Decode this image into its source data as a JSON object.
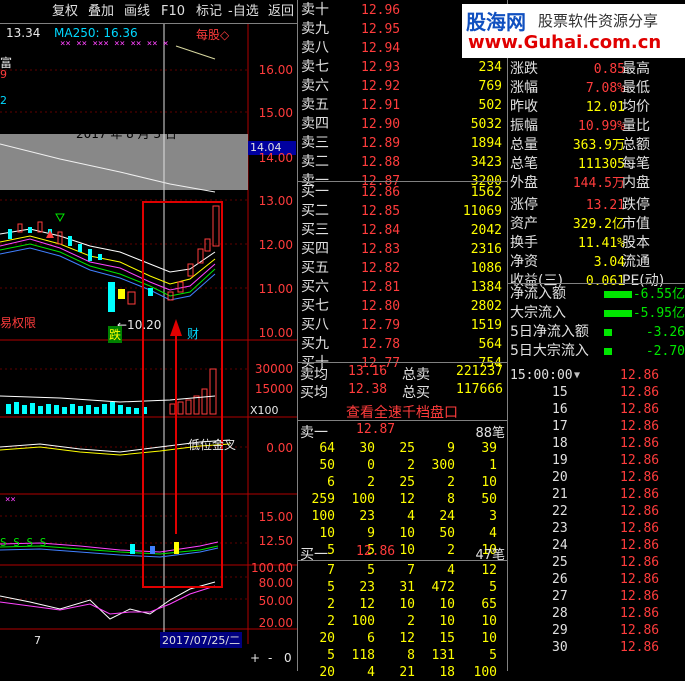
{
  "toolbar": {
    "items": [
      "复权",
      "叠加",
      "画线",
      "F10",
      "标记",
      "-自选",
      "返回"
    ]
  },
  "chart": {
    "ma_price": "13.34",
    "ma250": "MA250: 16.36",
    "every": "每股◇",
    "left_frag1": "富",
    "left_frag2": "9",
    "left_frag3": "2",
    "date_annot": "2017 年 8 月 3 日",
    "price_box": "14.04",
    "low_label": "←10.20",
    "tag_die": "跌",
    "tag_cai": "财",
    "rights_text": "易权限",
    "ind_label": "低位金叉",
    "x100": "X100",
    "bottom_date": "2017/07/25/二",
    "bottom_left": "7",
    "nav": [
      "+",
      "-",
      "0"
    ],
    "yticks_main": [
      "16.00",
      "15.00",
      "14.00",
      "13.00",
      "12.00",
      "11.00",
      "10.00"
    ],
    "yticks_vol": [
      "30000",
      "15000"
    ],
    "yticks_ind": [
      "0.00"
    ],
    "yticks_ind2": [
      "15.00",
      "12.50"
    ],
    "yticks_ind3": [
      "100.00",
      "80.00",
      "50.00",
      "20.00"
    ]
  },
  "watermark": {
    "line1": "股海网",
    "line2": "股票软件资源分享",
    "url": "www.Guhai.com.cn"
  },
  "orderbook": {
    "asks": [
      {
        "label": "卖十",
        "price": "12.96",
        "vol": ""
      },
      {
        "label": "卖九",
        "price": "12.95",
        "vol": ""
      },
      {
        "label": "卖八",
        "price": "12.94",
        "vol": ""
      },
      {
        "label": "卖七",
        "price": "12.93",
        "vol": "234"
      },
      {
        "label": "卖六",
        "price": "12.92",
        "vol": "769"
      },
      {
        "label": "卖五",
        "price": "12.91",
        "vol": "502"
      },
      {
        "label": "卖四",
        "price": "12.90",
        "vol": "5032"
      },
      {
        "label": "卖三",
        "price": "12.89",
        "vol": "1894"
      },
      {
        "label": "卖二",
        "price": "12.88",
        "vol": "3423"
      },
      {
        "label": "卖一",
        "price": "12.87",
        "vol": "3200"
      }
    ],
    "bids": [
      {
        "label": "买一",
        "price": "12.86",
        "vol": "1562"
      },
      {
        "label": "买二",
        "price": "12.85",
        "vol": "11069"
      },
      {
        "label": "买三",
        "price": "12.84",
        "vol": "2042"
      },
      {
        "label": "买四",
        "price": "12.83",
        "vol": "2316"
      },
      {
        "label": "买五",
        "price": "12.82",
        "vol": "1086"
      },
      {
        "label": "买六",
        "price": "12.81",
        "vol": "1384"
      },
      {
        "label": "买七",
        "price": "12.80",
        "vol": "2802"
      },
      {
        "label": "买八",
        "price": "12.79",
        "vol": "1519"
      },
      {
        "label": "买九",
        "price": "12.78",
        "vol": "564"
      },
      {
        "label": "买十",
        "price": "12.77",
        "vol": "754"
      }
    ],
    "avg_sell_label": "卖均",
    "avg_sell": "13.16",
    "total_sell_label": "总卖",
    "total_sell": "221237",
    "avg_buy_label": "买均",
    "avg_buy": "12.38",
    "total_buy_label": "总买",
    "total_buy": "117666",
    "view_all": "查看全速千档盘口"
  },
  "queue": {
    "sell_label": "卖一",
    "sell_price": "12.87",
    "sell_count": "88笔",
    "sell_rows": [
      [
        "64",
        "30",
        "25",
        "9",
        "39"
      ],
      [
        "50",
        "0",
        "2",
        "300",
        "1"
      ],
      [
        "6",
        "2",
        "25",
        "2",
        "10"
      ],
      [
        "259",
        "100",
        "12",
        "8",
        "50"
      ],
      [
        "100",
        "23",
        "4",
        "24",
        "3"
      ],
      [
        "10",
        "9",
        "10",
        "50",
        "4"
      ],
      [
        "5",
        "5",
        "10",
        "2",
        "10"
      ]
    ],
    "buy_label": "买一",
    "buy_price": "12.86",
    "buy_count": "47笔",
    "buy_rows": [
      [
        "7",
        "5",
        "7",
        "4",
        "12"
      ],
      [
        "5",
        "23",
        "31",
        "472",
        "5"
      ],
      [
        "2",
        "12",
        "10",
        "10",
        "65"
      ],
      [
        "2",
        "100",
        "2",
        "10",
        "10"
      ],
      [
        "20",
        "6",
        "12",
        "15",
        "10"
      ],
      [
        "5",
        "118",
        "8",
        "131",
        "5"
      ],
      [
        "20",
        "4",
        "21",
        "18",
        "100"
      ]
    ]
  },
  "stats": {
    "rows": [
      {
        "a": "涨跌",
        "b": "0.85",
        "c": "最高"
      },
      {
        "a": "涨幅",
        "b": "7.08%",
        "c": "最低"
      },
      {
        "a": "昨收",
        "b": "12.01",
        "c": "均价"
      },
      {
        "a": "振幅",
        "b": "10.99%",
        "c": "量比"
      },
      {
        "a": "总量",
        "b": "363.9万",
        "c": "总额"
      },
      {
        "a": "总笔",
        "b": "111305",
        "c": "每笔"
      },
      {
        "a": "外盘",
        "b": "144.5万",
        "c": "内盘"
      },
      {
        "a": "涨停",
        "b": "13.21",
        "c": "跌停"
      },
      {
        "a": "资产",
        "b": "329.2亿",
        "c": "市值"
      },
      {
        "a": "换手",
        "b": "11.41%",
        "c": "股本"
      },
      {
        "a": "净资",
        "b": "3.04",
        "c": "流通"
      },
      {
        "a": "收益(三)",
        "b": "0.061",
        "c": "PE(动)"
      }
    ],
    "flows": [
      {
        "a": "净流入额",
        "b": "-6.55亿"
      },
      {
        "a": "大宗流入",
        "b": "-5.95亿"
      },
      {
        "a": "5日净流入额",
        "b": "-3.26"
      },
      {
        "a": "5日大宗流入",
        "b": "-2.70"
      }
    ]
  },
  "ticks": {
    "header_time": "15:00:00",
    "header_price": "12.86",
    "rows": [
      {
        "t": "15",
        "p": "12.86"
      },
      {
        "t": "16",
        "p": "12.86"
      },
      {
        "t": "17",
        "p": "12.86"
      },
      {
        "t": "18",
        "p": "12.86"
      },
      {
        "t": "19",
        "p": "12.86"
      },
      {
        "t": "20",
        "p": "12.86"
      },
      {
        "t": "21",
        "p": "12.86"
      },
      {
        "t": "22",
        "p": "12.86"
      },
      {
        "t": "23",
        "p": "12.86"
      },
      {
        "t": "24",
        "p": "12.86"
      },
      {
        "t": "25",
        "p": "12.86"
      },
      {
        "t": "26",
        "p": "12.86"
      },
      {
        "t": "27",
        "p": "12.86"
      },
      {
        "t": "28",
        "p": "12.86"
      },
      {
        "t": "29",
        "p": "12.86"
      },
      {
        "t": "30",
        "p": "12.86"
      }
    ]
  }
}
